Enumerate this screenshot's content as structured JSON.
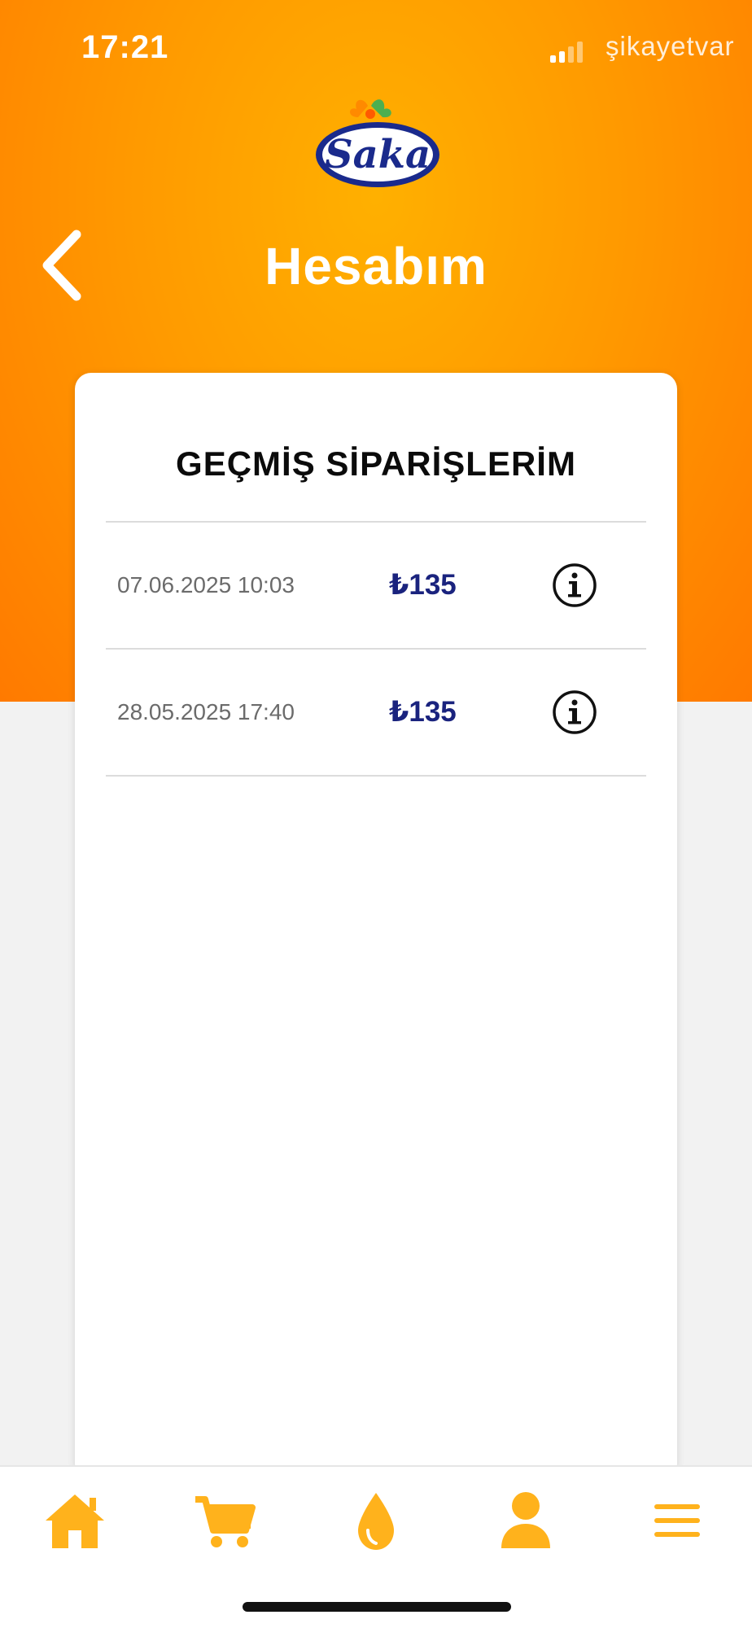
{
  "status_bar": {
    "time": "17:21",
    "watermark": "şikayetvar"
  },
  "header": {
    "logo_text": "Saka",
    "title": "Hesabım",
    "back_icon": "chevron-left-icon"
  },
  "orders": {
    "title": "GEÇMİŞ SİPARİŞLERİM",
    "items": [
      {
        "date": "07.06.2025 10:03",
        "amount": "₺135",
        "action_icon": "info-icon"
      },
      {
        "date": "28.05.2025 17:40",
        "amount": "₺135",
        "action_icon": "info-icon"
      }
    ]
  },
  "bottom_nav": {
    "items": [
      {
        "icon": "home-icon"
      },
      {
        "icon": "cart-icon"
      },
      {
        "icon": "water-drop-icon"
      },
      {
        "icon": "profile-icon"
      },
      {
        "icon": "menu-icon"
      }
    ]
  },
  "colors": {
    "header_gradient_center": "#ffb000",
    "header_gradient_edge": "#ff7a00",
    "amount": "#1a237e",
    "nav_icon": "#ffb21c",
    "logo_blue": "#1a2a8c"
  }
}
